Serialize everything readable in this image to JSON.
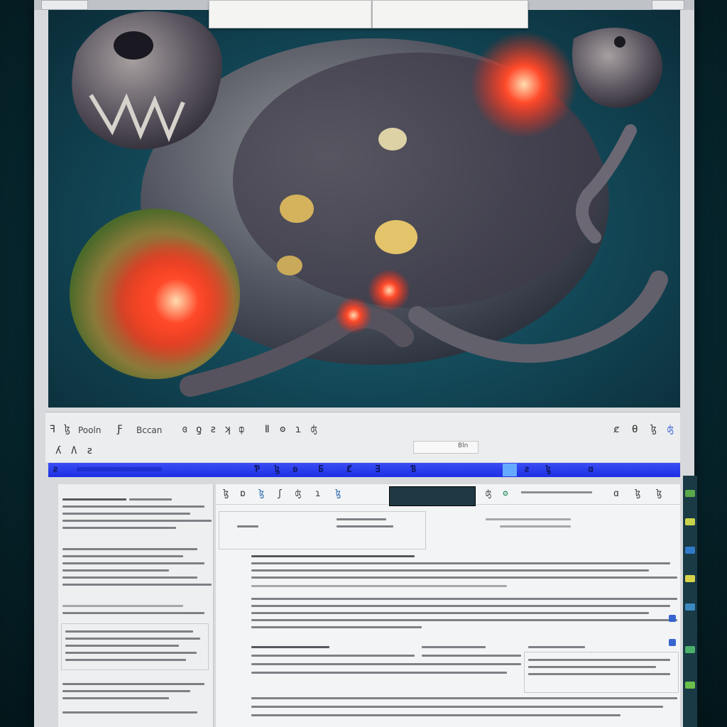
{
  "window": {
    "top_tabs": [
      "",
      ""
    ]
  },
  "toolbar": {
    "row1_buttons": [
      "ꟻ",
      "ɮ",
      "Ƒ",
      "ɞ",
      "ƍ",
      "ƨ",
      "ʞ",
      "ȹ",
      "ǁ",
      "ʘ",
      "ɿ",
      "ʤ"
    ],
    "row1_label_left": "Pooln",
    "row1_label_mid": "Bccan",
    "row1_right": [
      "ȼ",
      "Ɵ",
      "ɮ",
      "ʤ"
    ],
    "row2_buttons": [
      "ʎ",
      "Ʌ",
      "ƨ"
    ],
    "row2_field_text": "Bln"
  },
  "ribbon": {
    "items": [
      "ƨ",
      "Ƥ",
      "ɮ",
      "ʚ",
      "Ƃ",
      "Ȼ",
      "Ǝ",
      "Ɓ",
      "ƨ",
      "ɮ",
      "ɑ"
    ],
    "accent_color": "#2238ee"
  },
  "sub_toolbar": {
    "buttons": [
      "ɮ",
      "ɒ",
      "ɮ",
      "ʃ",
      "ʤ",
      "ɿ",
      "ɮ",
      "ʤ",
      "ʘ",
      "ɑ",
      "ɮ",
      "ɮ"
    ]
  },
  "icons": {
    "scroll": "scroll-marker-icon",
    "side": "sidebar-tool-icon"
  }
}
